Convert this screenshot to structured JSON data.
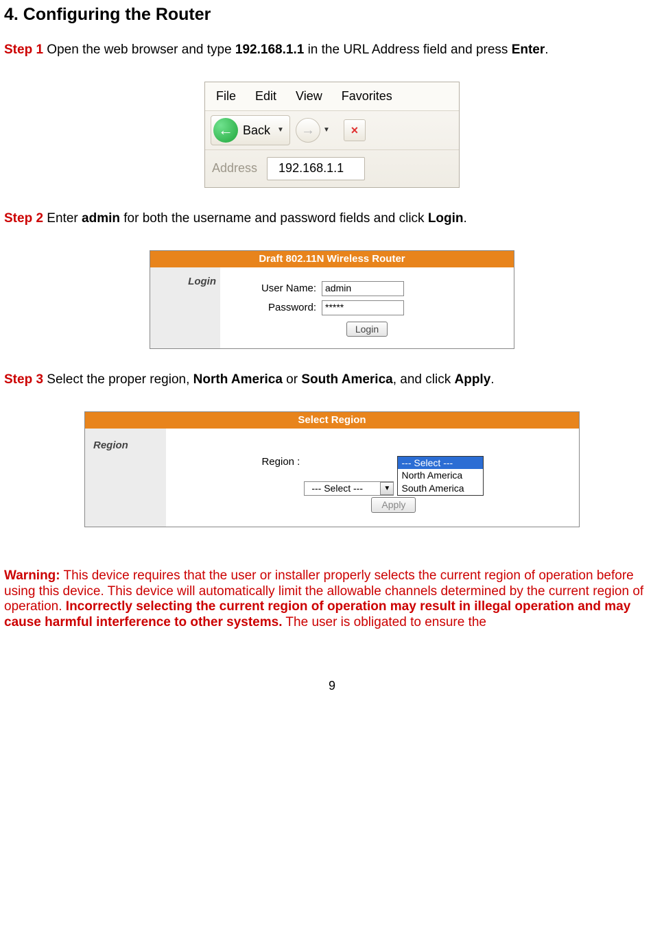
{
  "heading": "4. Configuring the Router",
  "step1": {
    "label": "Step 1",
    "pre": " Open the web browser and type ",
    "ip": "192.168.1.1",
    "post": " in the URL Address field and press ",
    "enter": "Enter",
    "period": "."
  },
  "browser": {
    "menu": {
      "file": "File",
      "edit": "Edit",
      "view": "View",
      "fav": "Favorites"
    },
    "back": "Back",
    "stop": "×",
    "fwd": "→",
    "addr_label": "Address",
    "addr_value": "192.168.1.1"
  },
  "step2": {
    "label": "Step 2",
    "pre": " Enter ",
    "admin": "admin",
    "mid": " for both the username and password fields and click ",
    "login": "Login",
    "period": "."
  },
  "login_panel": {
    "header": "Draft 802.11N Wireless Router",
    "side": "Login",
    "user_label": "User Name:",
    "user_value": "admin",
    "pass_label": "Password:",
    "pass_value": "*****",
    "button": "Login"
  },
  "step3": {
    "label": "Step 3",
    "pre": " Select the proper region, ",
    "na": "North America",
    "or": " or ",
    "sa": "South America",
    "post": ", and click ",
    "apply": "Apply",
    "period": "."
  },
  "region_panel": {
    "header": "Select Region",
    "side": "Region",
    "label": "Region :",
    "selected": "--- Select ---",
    "options": {
      "o1": "--- Select ---",
      "o2": "North America",
      "o3": "South America"
    },
    "apply": "Apply"
  },
  "warning": {
    "label": "Warning:",
    "t1": " This device requires that the user or installer properly selects the current region of operation before using this device. This device will automatically limit the allowable channels determined by the current region of operation.  ",
    "bold": "Incorrectly selecting the current region of operation may result in illegal operation and may cause harmful interference to other systems.",
    "t2": " The user is obligated to ensure the"
  },
  "page_number": "9"
}
